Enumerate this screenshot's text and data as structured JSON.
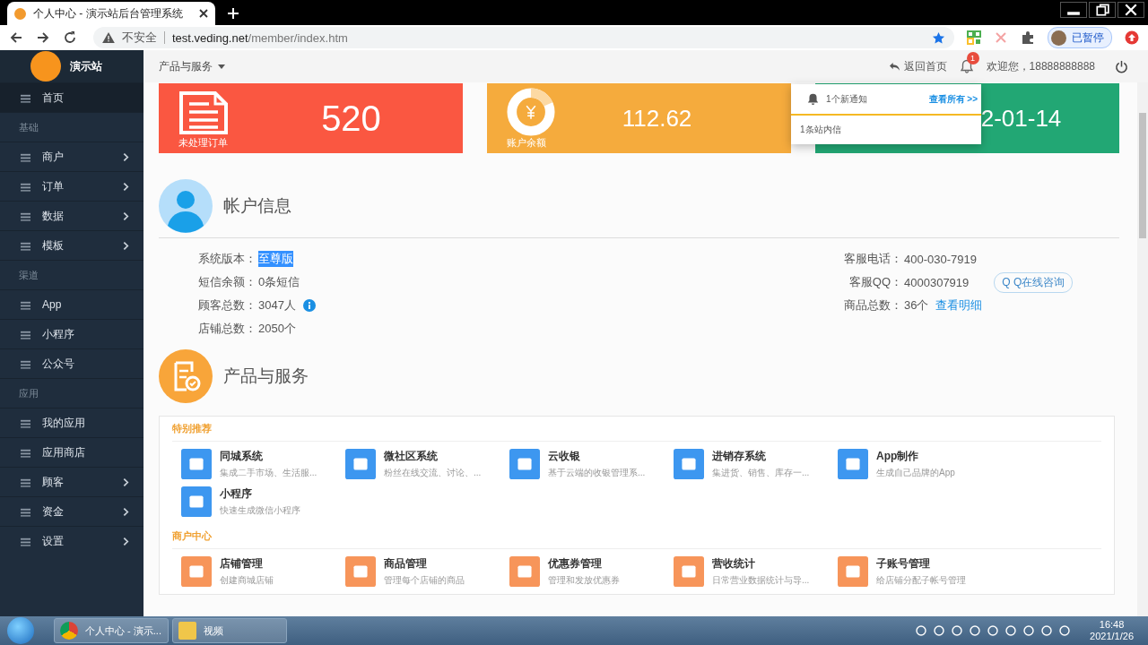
{
  "browser": {
    "tab_title": "个人中心 - 演示站后台管理系统",
    "security": "不安全",
    "url_host": "test.veding.net",
    "url_path": "/member/index.htm",
    "profile": "已暂停"
  },
  "sidebar": {
    "brand": "演示站",
    "items": [
      {
        "kind": "item",
        "label": "首页",
        "selected": true,
        "expandable": false
      },
      {
        "kind": "section",
        "label": "基础"
      },
      {
        "kind": "item",
        "label": "商户",
        "selected": false,
        "expandable": true
      },
      {
        "kind": "item",
        "label": "订单",
        "selected": false,
        "expandable": true
      },
      {
        "kind": "item",
        "label": "数据",
        "selected": false,
        "expandable": true
      },
      {
        "kind": "item",
        "label": "模板",
        "selected": false,
        "expandable": true
      },
      {
        "kind": "section",
        "label": "渠道"
      },
      {
        "kind": "item",
        "label": "App",
        "selected": false,
        "expandable": false
      },
      {
        "kind": "item",
        "label": "小程序",
        "selected": false,
        "expandable": false
      },
      {
        "kind": "item",
        "label": "公众号",
        "selected": false,
        "expandable": false
      },
      {
        "kind": "section",
        "label": "应用"
      },
      {
        "kind": "item",
        "label": "我的应用",
        "selected": false,
        "expandable": false
      },
      {
        "kind": "item",
        "label": "应用商店",
        "selected": false,
        "expandable": false
      },
      {
        "kind": "item",
        "label": "顾客",
        "selected": false,
        "expandable": true
      },
      {
        "kind": "item",
        "label": "资金",
        "selected": false,
        "expandable": true
      },
      {
        "kind": "item",
        "label": "设置",
        "selected": false,
        "expandable": true
      }
    ]
  },
  "topbar": {
    "menu": "产品与服务",
    "home_link": "返回首页",
    "notification_count": "1",
    "welcome": "欢迎您，18888888888"
  },
  "notifications": {
    "header": "1个新通知",
    "view_all": "查看所有 >>",
    "items": [
      "1条站内信"
    ]
  },
  "stats": [
    {
      "kind": "document",
      "value": "520",
      "label": "未处理订单",
      "color": "#fa5741"
    },
    {
      "kind": "coin",
      "value": "112.62",
      "label": "账户余额",
      "color": "#f5ab3d"
    },
    {
      "kind": "hidden",
      "value": "2-01-14",
      "color": "#22a774"
    }
  ],
  "account": {
    "title": "帐户信息",
    "left": [
      {
        "kind": "plain",
        "label": "系统版本：",
        "value": "至尊版",
        "selected": true
      },
      {
        "kind": "plain",
        "label": "短信余额：",
        "value": "0条短信",
        "selected": false
      },
      {
        "kind": "with_info",
        "label": "顾客总数：",
        "value": "3047人",
        "selected": false
      },
      {
        "kind": "plain",
        "label": "店铺总数：",
        "value": "2050个",
        "selected": false
      }
    ],
    "right": [
      {
        "label": "客服电话：",
        "value": "400-030-7919"
      },
      {
        "label": "客服QQ：",
        "value": "4000307919",
        "button": "Q Q在线咨询"
      },
      {
        "label": "商品总数：",
        "value": "36个",
        "link": "查看明细"
      }
    ]
  },
  "products": {
    "title": "产品与服务",
    "sections": [
      {
        "title": "特别推荐",
        "color": "#3d97f0",
        "items": [
          {
            "name": "同城系统",
            "desc": "集成二手市场、生活服..."
          },
          {
            "name": "微社区系统",
            "desc": "粉丝在线交流、讨论、..."
          },
          {
            "name": "云收银",
            "desc": "基于云端的收银管理系..."
          },
          {
            "name": "进销存系统",
            "desc": "集进货、销售、库存一..."
          },
          {
            "name": "App制作",
            "desc": "生成自己品牌的App"
          },
          {
            "name": "小程序",
            "desc": "快速生成微信小程序"
          }
        ]
      },
      {
        "title": "商户中心",
        "color": "#f7955a",
        "items": [
          {
            "name": "店铺管理",
            "desc": "创建商城店铺"
          },
          {
            "name": "商品管理",
            "desc": "管理每个店铺的商品"
          },
          {
            "name": "优惠券管理",
            "desc": "管理和发放优惠券"
          },
          {
            "name": "营收统计",
            "desc": "日常营业数据统计与导..."
          },
          {
            "name": "子账号管理",
            "desc": "给店铺分配子帐号管理"
          }
        ]
      }
    ]
  },
  "taskbar": {
    "tasks": [
      "个人中心 - 演示...",
      "视频"
    ],
    "time": "16:48",
    "date": "2021/1/26"
  }
}
